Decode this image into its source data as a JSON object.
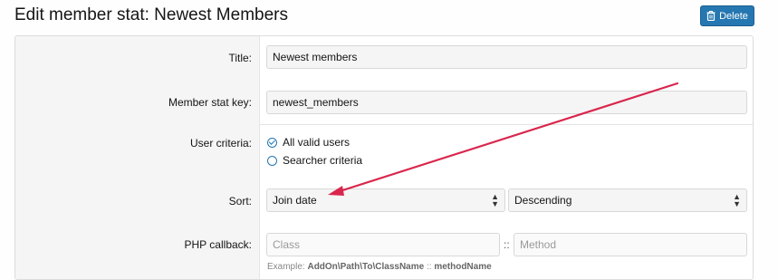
{
  "page": {
    "title": "Edit member stat: Newest Members"
  },
  "toolbar": {
    "delete_label": "Delete"
  },
  "form": {
    "title": {
      "label": "Title:",
      "value": "Newest members"
    },
    "stat_key": {
      "label": "Member stat key:",
      "value": "newest_members"
    },
    "criteria": {
      "label": "User criteria:",
      "options": [
        "All valid users",
        "Searcher criteria"
      ],
      "selected": "All valid users"
    },
    "sort": {
      "label": "Sort:",
      "field_value": "Join date",
      "order_value": "Descending"
    },
    "callback": {
      "label": "PHP callback:",
      "class_placeholder": "Class",
      "separator": "::",
      "method_placeholder": "Method",
      "example_prefix": "Example:",
      "example_class": "AddOn\\Path\\To\\ClassName",
      "example_sep": "::",
      "example_method": "methodName"
    }
  },
  "colors": {
    "accent": "#2577b1",
    "annotation_arrow": "#d9264d"
  }
}
